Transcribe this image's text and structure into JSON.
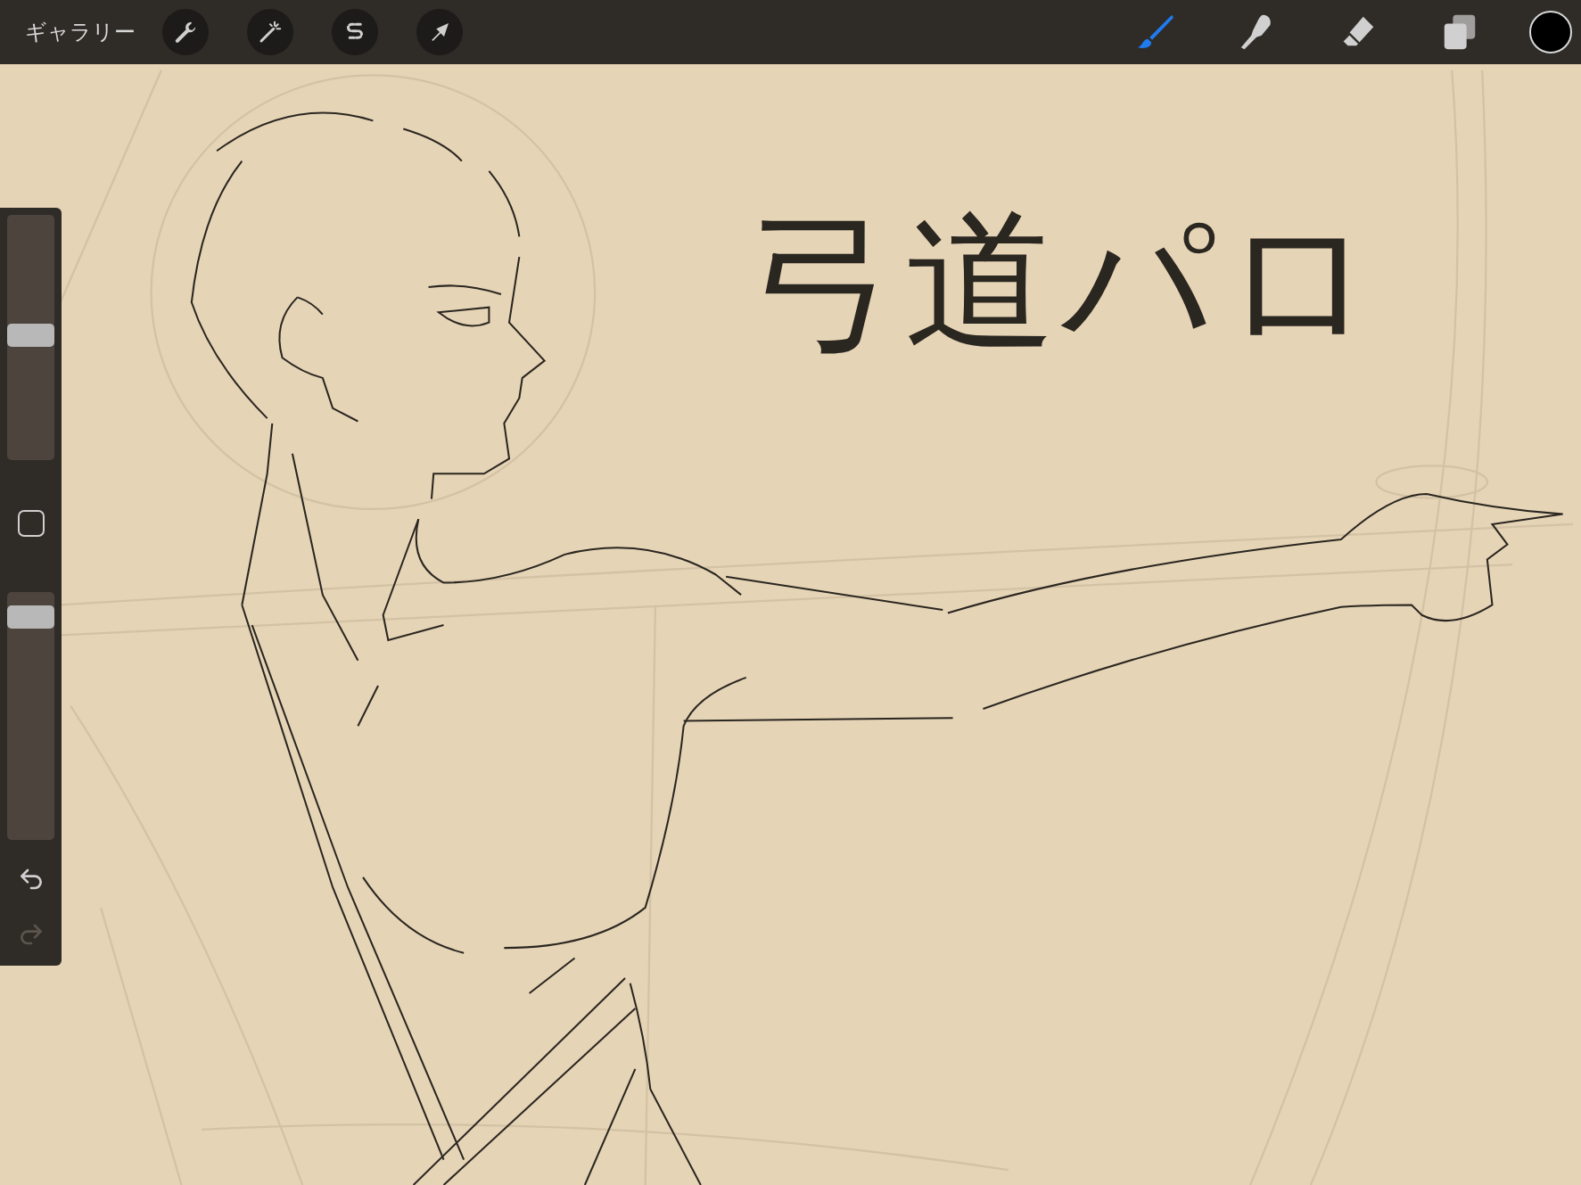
{
  "toolbar": {
    "gallery_label": "ギャラリー",
    "left_tools": [
      {
        "kind": "actions"
      },
      {
        "kind": "adjustments"
      },
      {
        "kind": "selection"
      },
      {
        "kind": "transform"
      }
    ],
    "right_tools": [
      {
        "kind": "brush",
        "selected": true
      },
      {
        "kind": "smudge",
        "selected": false
      },
      {
        "kind": "eraser",
        "selected": false
      },
      {
        "kind": "layers",
        "selected": false
      }
    ],
    "color_swatch": {
      "color": "#000000"
    }
  },
  "sidebar": {
    "size_slider": {
      "level": 0.51
    },
    "opacity_slider": {
      "level": 0.94
    },
    "undo": {
      "disabled": false
    },
    "redo": {
      "disabled": true
    }
  },
  "canvas": {
    "caption": "弓道パロ"
  }
}
